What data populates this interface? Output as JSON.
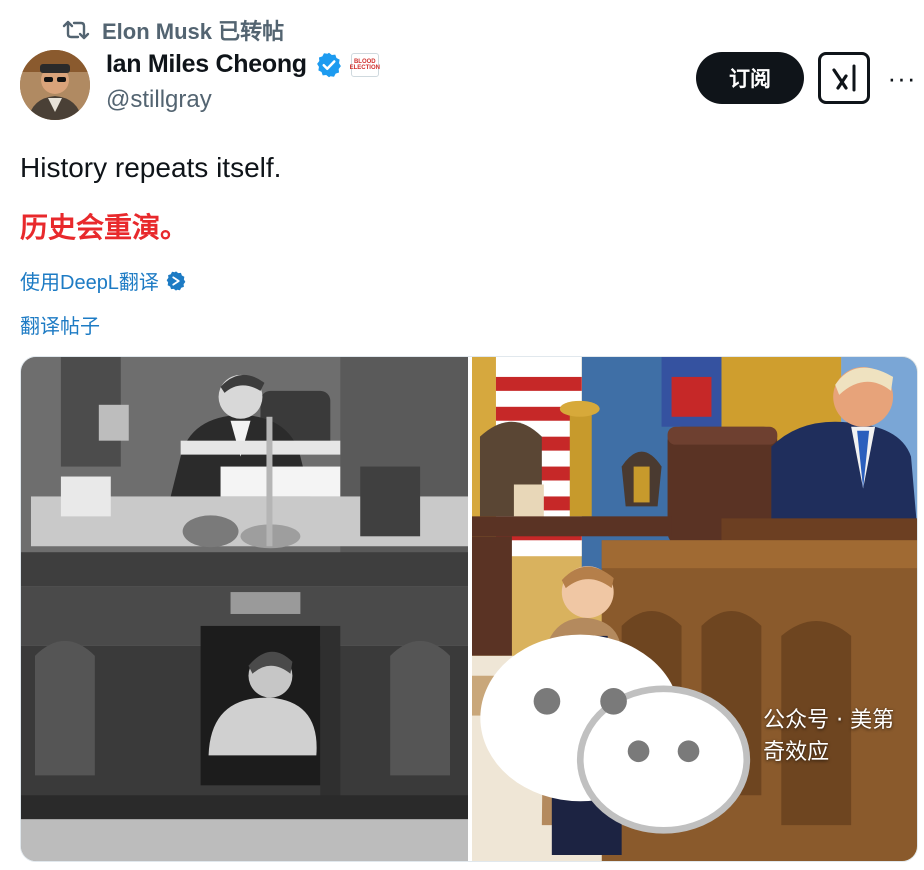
{
  "repost": {
    "label": "Elon Musk 已转帖"
  },
  "author": {
    "name": "Ian Miles Cheong",
    "handle": "@stillgray",
    "affiliation_badge": "BLOOD ELECTION"
  },
  "actions": {
    "subscribe_label": "订阅",
    "more_label": "···"
  },
  "post": {
    "text_en": "History repeats itself.",
    "text_zh": "历史会重演。",
    "translate_label": "使用DeepL翻译",
    "translate_post_label": "翻译帖子"
  },
  "media": {
    "watermark": "公众号 · 美第奇效应"
  },
  "colors": {
    "accent_blue": "#1d9bf0",
    "link_blue": "#1d7bc4",
    "red_text": "#e8292c",
    "text_primary": "#0f1419",
    "text_secondary": "#536471"
  }
}
